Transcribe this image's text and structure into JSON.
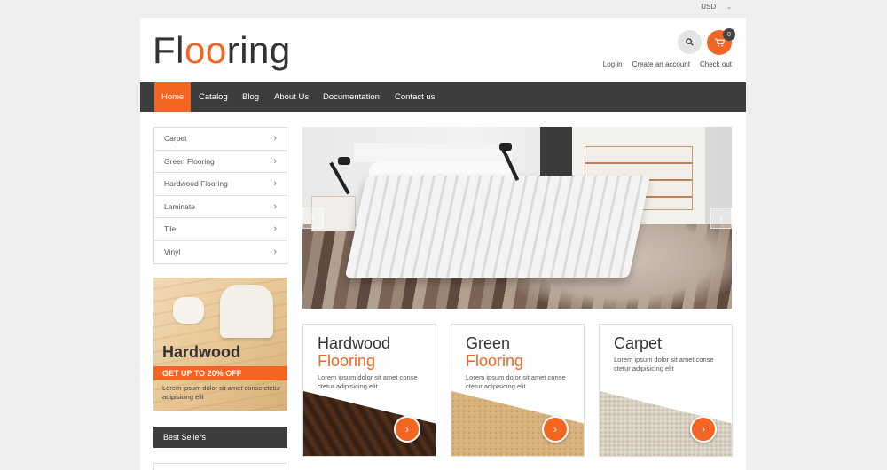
{
  "topbar": {
    "currency": "USD"
  },
  "header": {
    "logo_prefix": "Fl",
    "logo_accent": "oo",
    "logo_suffix": "ring",
    "cart_count": "0",
    "links": [
      "Log in",
      "Create an account",
      "Check out"
    ]
  },
  "nav": {
    "items": [
      "Home",
      "Catalog",
      "Blog",
      "About Us",
      "Documentation",
      "Contact us"
    ],
    "active": "Home"
  },
  "sidebar": {
    "categories": [
      "Carpet",
      "Green Flooring",
      "Hardwood Flooring",
      "Laminate",
      "Tile",
      "Vinyl"
    ],
    "promo": {
      "title": "Hardwood",
      "offer": "GET UP TO 20% OFF",
      "text": "Lorem ipsum dolor sit amet conse ctetur adipisicing elit"
    },
    "best_sellers": "Best Sellers"
  },
  "tiles": [
    {
      "title": "Hardwood",
      "subtitle": "Flooring",
      "text": "Lorem ipsum dolor sit amet conse ctetur adipisicing elit"
    },
    {
      "title": "Green",
      "subtitle": "Flooring",
      "text": "Lorem ipsum dolor sit amet conse ctetur adipisicing elit"
    },
    {
      "title": "Carpet",
      "subtitle": "",
      "text": "Lorem ipsum dolor sit amet conse ctetur adipisicing elit"
    }
  ],
  "colors": {
    "accent": "#f26522",
    "nav_bg": "#3d3d3d"
  },
  "icons": {
    "search": "search-icon",
    "cart": "cart-icon",
    "slide_prev": "chevron-left-icon",
    "slide_next": "chevron-right-icon",
    "tile_go": "chevron-right-icon"
  }
}
